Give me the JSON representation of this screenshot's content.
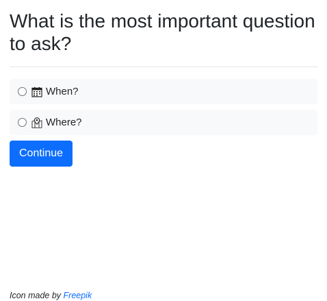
{
  "question": {
    "title": "What is the most important question to ask?"
  },
  "options": [
    {
      "label": "When?",
      "icon": "calendar-icon",
      "selected": false
    },
    {
      "label": "Where?",
      "icon": "map-pin-icon",
      "selected": false
    }
  ],
  "actions": {
    "continue_label": "Continue"
  },
  "footer": {
    "prefix": "Icon made by",
    "link_text": "Freepik"
  },
  "colors": {
    "primary": "#0d6efd",
    "option_bg": "#f8f9fa",
    "text": "#212529"
  }
}
